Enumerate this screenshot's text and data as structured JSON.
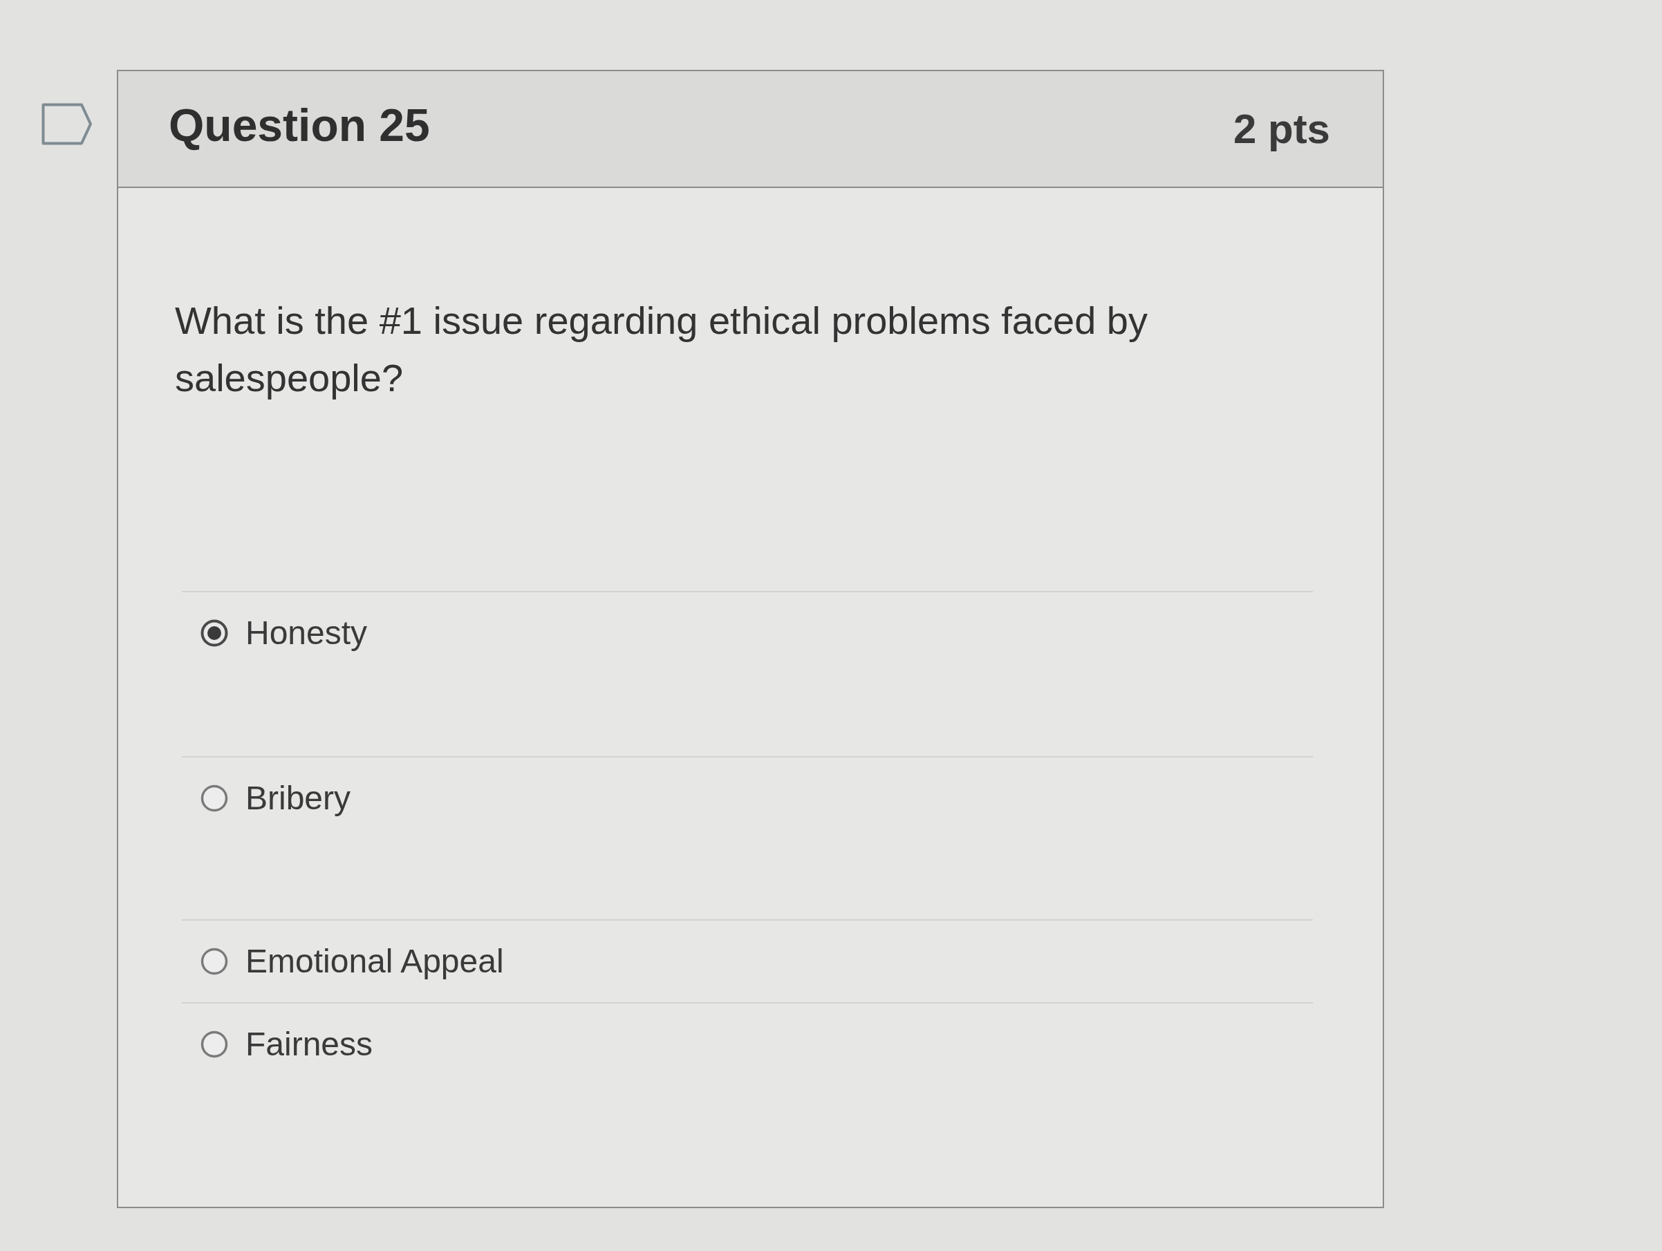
{
  "question": {
    "title": "Question 25",
    "points": "2 pts",
    "text": "What is the #1 issue regarding ethical problems faced by salespeople?"
  },
  "answers": [
    {
      "label": "Honesty",
      "selected": true
    },
    {
      "label": "Bribery",
      "selected": false
    },
    {
      "label": "Emotional Appeal",
      "selected": false
    },
    {
      "label": "Fairness",
      "selected": false
    }
  ]
}
